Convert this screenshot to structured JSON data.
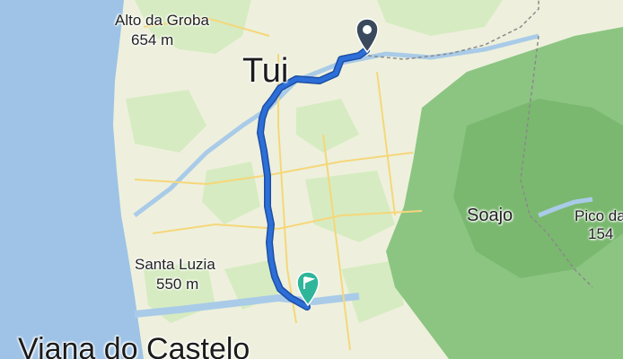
{
  "map": {
    "colors": {
      "sea": "#9ec3e6",
      "land": "#eef0dd",
      "forest": "#cfe7b8",
      "forest_dark": "#86c27a",
      "river": "#a9cbe8",
      "route": "#2d6fd8",
      "route_casing": "#1d4fa3",
      "road": "#f5d77a",
      "border": "#8a8a8a",
      "start_marker": "#3a4a5c",
      "end_marker": "#2fb59a"
    },
    "places": [
      {
        "id": "alto-da-groba",
        "name": "Alto da Groba"
      },
      {
        "id": "alto-da-groba-elev",
        "name": "654 m"
      },
      {
        "id": "tui",
        "name": "Tui"
      },
      {
        "id": "soajo",
        "name": "Soajo"
      },
      {
        "id": "pico-da",
        "name": "Pico da"
      },
      {
        "id": "pico-da-elev",
        "name": "154"
      },
      {
        "id": "santa-luzia",
        "name": "Santa Luzia"
      },
      {
        "id": "santa-luzia-elev",
        "name": "550 m"
      },
      {
        "id": "viana-do-castelo",
        "name": "Viana do Castelo"
      }
    ],
    "markers": {
      "start": "location-pin-icon",
      "end": "flag-pin-icon"
    }
  }
}
